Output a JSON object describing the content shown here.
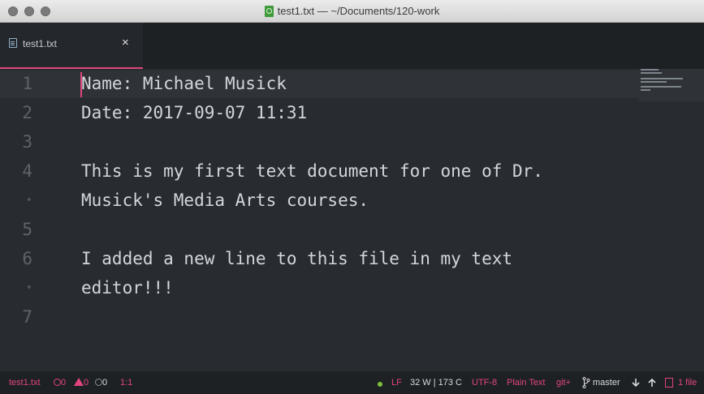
{
  "window": {
    "title": "test1.txt — ~/Documents/120-work"
  },
  "tab": {
    "label": "test1.txt",
    "close": "×"
  },
  "gutter": {
    "numbers": [
      "1",
      "2",
      "3",
      "4",
      "•",
      "5",
      "6",
      "•",
      "7"
    ]
  },
  "editor": {
    "lines": [
      "Name: Michael Musick",
      "Date: 2017-09-07 11:31",
      "",
      "This is my first text document for one of Dr.",
      "Musick's Media Arts courses.",
      "",
      "I added a new line to this file in my text",
      "editor!!!",
      ""
    ]
  },
  "status": {
    "file": "test1.txt",
    "errors": "0",
    "warnings": "0",
    "infos": "0",
    "cursor": "1:1",
    "line_ending": "LF",
    "word_count": "32 W | 173 C",
    "encoding": "UTF-8",
    "grammar": "Plain Text",
    "git_plus": "git+",
    "branch": "master",
    "files": "1 file"
  },
  "colors": {
    "accent": "#e0457b",
    "editor_bg": "#282c30",
    "statusbar_bg": "#1e2124"
  },
  "icons": [
    "close-icon",
    "document-icon",
    "error-icon",
    "warning-icon",
    "info-icon",
    "git-branch-icon",
    "arrow-down-icon",
    "arrow-up-icon"
  ]
}
